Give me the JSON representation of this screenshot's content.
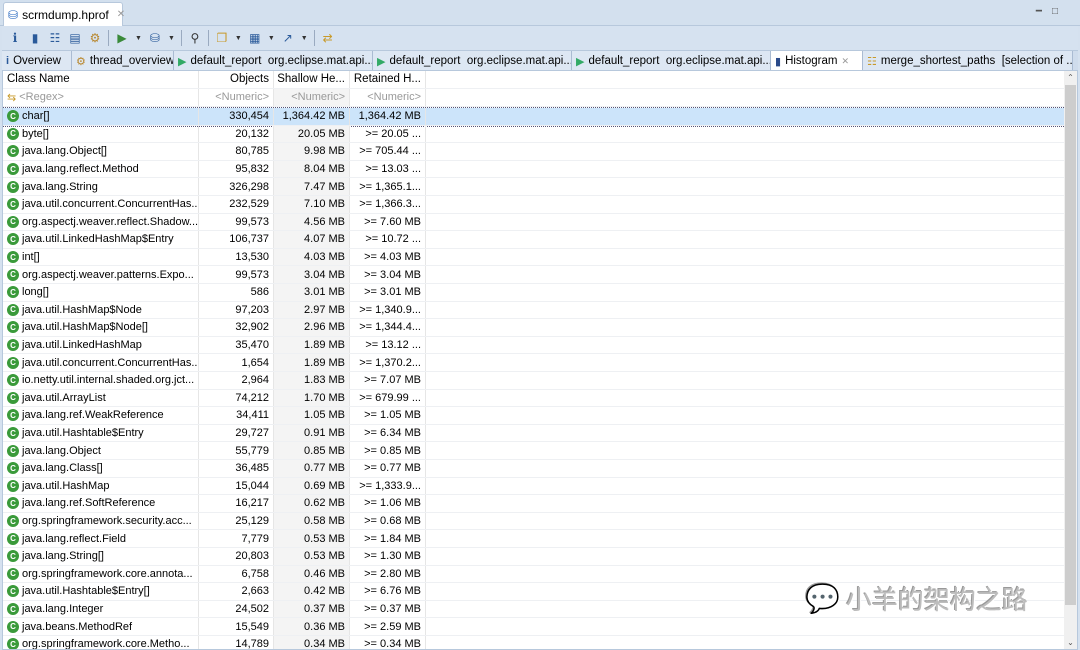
{
  "file_tab": {
    "title": "scrmdump.hprof"
  },
  "tabs": [
    {
      "label": "Overview",
      "icon": "info-icon"
    },
    {
      "label": "thread_overview",
      "icon": "gear-icon"
    },
    {
      "label": "default_report  org.eclipse.mat.api...",
      "icon": "report-icon"
    },
    {
      "label": "default_report  org.eclipse.mat.api...",
      "icon": "report-icon"
    },
    {
      "label": "default_report  org.eclipse.mat.api...",
      "icon": "report-icon"
    },
    {
      "label": "Histogram",
      "icon": "histogram-icon",
      "active": true
    },
    {
      "label": "merge_shortest_paths  [selection of ...",
      "icon": "tree-icon"
    }
  ],
  "table": {
    "headers": [
      "Class Name",
      "Objects",
      "Shallow He...",
      "Retained H..."
    ],
    "filters": [
      "<Regex>",
      "<Numeric>",
      "<Numeric>",
      "<Numeric>"
    ],
    "rows": [
      [
        "char[]",
        "330,454",
        "1,364.42 MB",
        "1,364.42 MB"
      ],
      [
        "byte[]",
        "20,132",
        "20.05 MB",
        ">= 20.05 ..."
      ],
      [
        "java.lang.Object[]",
        "80,785",
        "9.98 MB",
        ">= 705.44 ..."
      ],
      [
        "java.lang.reflect.Method",
        "95,832",
        "8.04 MB",
        ">= 13.03 ..."
      ],
      [
        "java.lang.String",
        "326,298",
        "7.47 MB",
        ">= 1,365.1..."
      ],
      [
        "java.util.concurrent.ConcurrentHas...",
        "232,529",
        "7.10 MB",
        ">= 1,366.3..."
      ],
      [
        "org.aspectj.weaver.reflect.Shadow...",
        "99,573",
        "4.56 MB",
        ">= 7.60 MB"
      ],
      [
        "java.util.LinkedHashMap$Entry",
        "106,737",
        "4.07 MB",
        ">= 10.72 ..."
      ],
      [
        "int[]",
        "13,530",
        "4.03 MB",
        ">= 4.03 MB"
      ],
      [
        "org.aspectj.weaver.patterns.Expo...",
        "99,573",
        "3.04 MB",
        ">= 3.04 MB"
      ],
      [
        "long[]",
        "586",
        "3.01 MB",
        ">= 3.01 MB"
      ],
      [
        "java.util.HashMap$Node",
        "97,203",
        "2.97 MB",
        ">= 1,340.9..."
      ],
      [
        "java.util.HashMap$Node[]",
        "32,902",
        "2.96 MB",
        ">= 1,344.4..."
      ],
      [
        "java.util.LinkedHashMap",
        "35,470",
        "1.89 MB",
        ">= 13.12 ..."
      ],
      [
        "java.util.concurrent.ConcurrentHas...",
        "1,654",
        "1.89 MB",
        ">= 1,370.2..."
      ],
      [
        "io.netty.util.internal.shaded.org.jct...",
        "2,964",
        "1.83 MB",
        ">= 7.07 MB"
      ],
      [
        "java.util.ArrayList",
        "74,212",
        "1.70 MB",
        ">= 679.99 ..."
      ],
      [
        "java.lang.ref.WeakReference",
        "34,411",
        "1.05 MB",
        ">= 1.05 MB"
      ],
      [
        "java.util.Hashtable$Entry",
        "29,727",
        "0.91 MB",
        ">= 6.34 MB"
      ],
      [
        "java.lang.Object",
        "55,779",
        "0.85 MB",
        ">= 0.85 MB"
      ],
      [
        "java.lang.Class[]",
        "36,485",
        "0.77 MB",
        ">= 0.77 MB"
      ],
      [
        "java.util.HashMap",
        "15,044",
        "0.69 MB",
        ">= 1,333.9..."
      ],
      [
        "java.lang.ref.SoftReference",
        "16,217",
        "0.62 MB",
        ">= 1.06 MB"
      ],
      [
        "org.springframework.security.acc...",
        "25,129",
        "0.58 MB",
        ">= 0.68 MB"
      ],
      [
        "java.lang.reflect.Field",
        "7,779",
        "0.53 MB",
        ">= 1.84 MB"
      ],
      [
        "java.lang.String[]",
        "20,803",
        "0.53 MB",
        ">= 1.30 MB"
      ],
      [
        "org.springframework.core.annota...",
        "6,758",
        "0.46 MB",
        ">= 2.80 MB"
      ],
      [
        "java.util.Hashtable$Entry[]",
        "2,663",
        "0.42 MB",
        ">= 6.76 MB"
      ],
      [
        "java.lang.Integer",
        "24,502",
        "0.37 MB",
        ">= 0.37 MB"
      ],
      [
        "java.beans.MethodRef",
        "15,549",
        "0.36 MB",
        ">= 2.59 MB"
      ],
      [
        "org.springframework.core.Metho...",
        "14,789",
        "0.34 MB",
        ">= 0.34 MB"
      ]
    ],
    "selected_row": 0
  },
  "watermark": {
    "text": "小羊的架构之路"
  },
  "colors": {
    "selection": "#cce4fa",
    "class_icon": "#3a9a3a",
    "chrome": "#d5e1ef"
  }
}
